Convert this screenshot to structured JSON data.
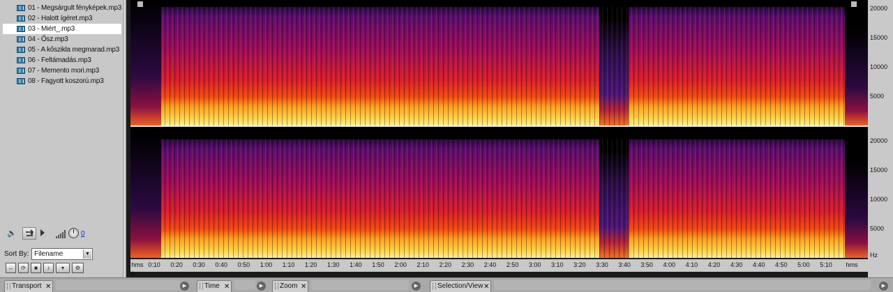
{
  "files": {
    "items": [
      {
        "name": "01 - Megsárgult fényképek.mp3",
        "selected": false
      },
      {
        "name": "02 - Halott ígéret.mp3",
        "selected": false
      },
      {
        "name": "03 - Miért_.mp3",
        "selected": true
      },
      {
        "name": "04 - Ősz.mp3",
        "selected": false
      },
      {
        "name": "05 - A kőszikla megmarad.mp3",
        "selected": false
      },
      {
        "name": "06 - Feltámadás.mp3",
        "selected": false
      },
      {
        "name": "07 - Memento mori.mp3",
        "selected": false
      },
      {
        "name": "08 - Fagyott koszorú.mp3",
        "selected": false
      }
    ],
    "volume_value": "0",
    "sort_by_label": "Sort By:",
    "sort_by_value": "Filename"
  },
  "spectral": {
    "freq_ticks": [
      "20000",
      "15000",
      "10000",
      "5000"
    ],
    "freq_unit": "Hz",
    "time_labels": [
      "hms",
      "0:10",
      "0:20",
      "0:30",
      "0:40",
      "0:50",
      "1:00",
      "1:10",
      "1:20",
      "1:30",
      "1:40",
      "1:50",
      "2:00",
      "2:10",
      "2:20",
      "2:30",
      "2:40",
      "2:50",
      "3:00",
      "3:10",
      "3:20",
      "3:30",
      "3:40",
      "3:50",
      "4:00",
      "4:10",
      "4:20",
      "4:30",
      "4:40",
      "4:50",
      "5:00",
      "5:10",
      "hms"
    ]
  },
  "dock": {
    "tabs": [
      "Transport",
      "Time",
      "Zoom",
      "Selection/View"
    ]
  }
}
